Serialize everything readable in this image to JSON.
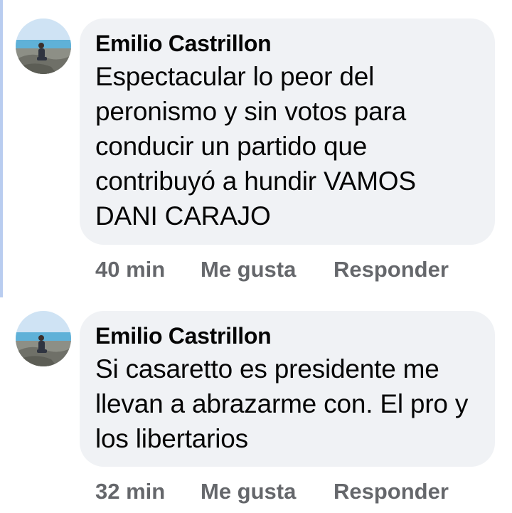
{
  "comments": [
    {
      "author": "Emilio Castrillon",
      "text": "Espectacular lo peor del peronismo y sin votos para conducir un partido que contribuyó a hundir VAMOS DANI CARAJO",
      "time": "40 min",
      "like_label": "Me gusta",
      "reply_label": "Responder",
      "avatar_icon": "profile-photo-beach-icon"
    },
    {
      "author": "Emilio Castrillon",
      "text": "Si casaretto es presidente me llevan a abrazarme con. El pro y los libertarios",
      "time": "32 min",
      "like_label": "Me gusta",
      "reply_label": "Responder",
      "avatar_icon": "profile-photo-beach-icon"
    }
  ],
  "colors": {
    "bubble_bg": "#f0f2f5",
    "text": "#050505",
    "secondary_text": "#65676b",
    "thread_line": "#b9cdf0"
  }
}
